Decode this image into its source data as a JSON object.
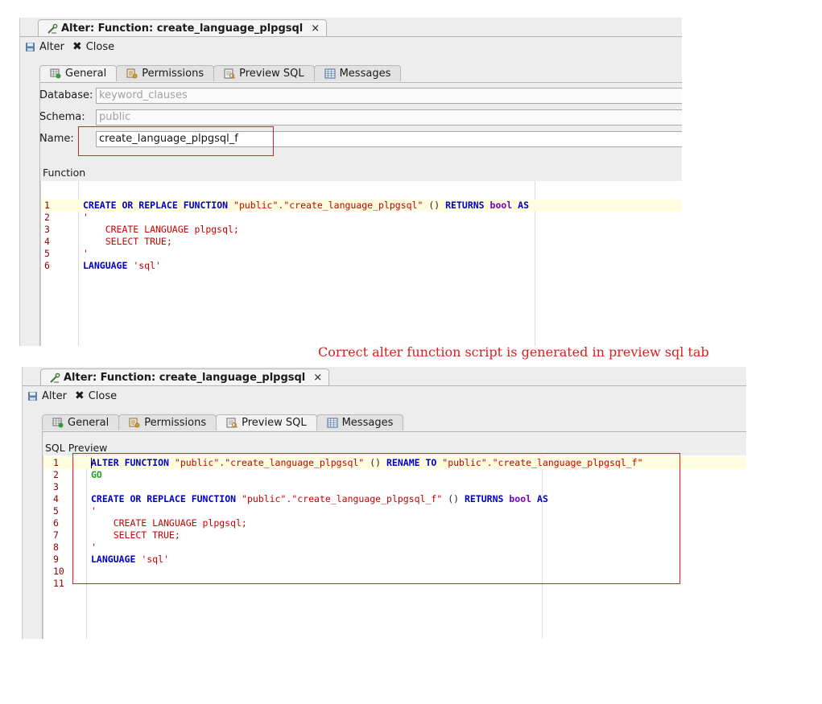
{
  "annotation": {
    "caption": "Correct alter function script is generated in preview sql tab"
  },
  "top": {
    "editor_tab_title": "Alter: Function: create_language_plpgsql",
    "close_tab": "×",
    "toolbar": {
      "alter_label": "Alter",
      "close_label": "Close"
    },
    "tabs": [
      {
        "label": "General",
        "icon": "general-table-icon",
        "active": true
      },
      {
        "label": "Permissions",
        "icon": "permissions-icon",
        "active": false
      },
      {
        "label": "Preview SQL",
        "icon": "preview-sql-icon",
        "active": false
      },
      {
        "label": "Messages",
        "icon": "messages-icon",
        "active": false
      }
    ],
    "fields": {
      "database_label": "Database:",
      "database_value": "keyword_clauses",
      "schema_label": "Schema:",
      "schema_value": "public",
      "name_label": "Name:",
      "name_value": "create_language_plpgsql_f"
    },
    "section_title": "Function",
    "code": [
      {
        "n": "1",
        "tokens": [
          [
            "kw",
            "CREATE"
          ],
          [
            "pln",
            " "
          ],
          [
            "kw",
            "OR"
          ],
          [
            "pln",
            " "
          ],
          [
            "kw",
            "REPLACE"
          ],
          [
            "pln",
            " "
          ],
          [
            "kw",
            "FUNCTION"
          ],
          [
            "pln",
            " "
          ],
          [
            "str",
            "\"public\".\"create_language_plpgsql\""
          ],
          [
            "pln",
            " () "
          ],
          [
            "kw",
            "RETURNS"
          ],
          [
            "pln",
            " "
          ],
          [
            "typ",
            "bool"
          ],
          [
            "pln",
            " "
          ],
          [
            "kw",
            "AS"
          ]
        ]
      },
      {
        "n": "2",
        "tokens": [
          [
            "str",
            "'"
          ]
        ]
      },
      {
        "n": "3",
        "tokens": [
          [
            "str",
            "    CREATE LANGUAGE plpgsql;"
          ]
        ]
      },
      {
        "n": "4",
        "tokens": [
          [
            "str",
            "    SELECT TRUE;"
          ]
        ]
      },
      {
        "n": "5",
        "tokens": [
          [
            "str",
            "'"
          ]
        ]
      },
      {
        "n": "6",
        "tokens": [
          [
            "kw",
            "LANGUAGE"
          ],
          [
            "pln",
            " "
          ],
          [
            "str",
            "'sql'"
          ]
        ]
      }
    ]
  },
  "bottom": {
    "editor_tab_title": "Alter: Function: create_language_plpgsql",
    "close_tab": "×",
    "toolbar": {
      "alter_label": "Alter",
      "close_label": "Close"
    },
    "tabs": [
      {
        "label": "General",
        "icon": "general-table-icon",
        "active": false
      },
      {
        "label": "Permissions",
        "icon": "permissions-icon",
        "active": false
      },
      {
        "label": "Preview SQL",
        "icon": "preview-sql-icon",
        "active": true
      },
      {
        "label": "Messages",
        "icon": "messages-icon",
        "active": false
      }
    ],
    "section_title": "SQL Preview",
    "code": [
      {
        "n": "1",
        "tokens": [
          [
            "kw",
            "ALTER"
          ],
          [
            "pln",
            " "
          ],
          [
            "kw",
            "FUNCTION"
          ],
          [
            "pln",
            " "
          ],
          [
            "str",
            "\"public\".\"create_language_plpgsql\""
          ],
          [
            "pln",
            " () "
          ],
          [
            "kw",
            "RENAME"
          ],
          [
            "pln",
            " "
          ],
          [
            "kw",
            "TO"
          ],
          [
            "pln",
            " "
          ],
          [
            "str",
            "\"public\".\"create_language_plpgsql_f\""
          ]
        ]
      },
      {
        "n": "2",
        "tokens": [
          [
            "go",
            "GO"
          ]
        ]
      },
      {
        "n": "3",
        "tokens": []
      },
      {
        "n": "4",
        "tokens": [
          [
            "kw",
            "CREATE"
          ],
          [
            "pln",
            " "
          ],
          [
            "kw",
            "OR"
          ],
          [
            "pln",
            " "
          ],
          [
            "kw",
            "REPLACE"
          ],
          [
            "pln",
            " "
          ],
          [
            "kw",
            "FUNCTION"
          ],
          [
            "pln",
            " "
          ],
          [
            "str",
            "\"public\".\"create_language_plpgsql_f\""
          ],
          [
            "pln",
            " () "
          ],
          [
            "kw",
            "RETURNS"
          ],
          [
            "pln",
            " "
          ],
          [
            "typ",
            "bool"
          ],
          [
            "pln",
            " "
          ],
          [
            "kw",
            "AS"
          ]
        ]
      },
      {
        "n": "5",
        "tokens": [
          [
            "str",
            "'"
          ]
        ]
      },
      {
        "n": "6",
        "tokens": [
          [
            "str",
            "    CREATE LANGUAGE plpgsql;"
          ]
        ]
      },
      {
        "n": "7",
        "tokens": [
          [
            "str",
            "    SELECT TRUE;"
          ]
        ]
      },
      {
        "n": "8",
        "tokens": [
          [
            "str",
            "'"
          ]
        ]
      },
      {
        "n": "9",
        "tokens": [
          [
            "kw",
            "LANGUAGE"
          ],
          [
            "pln",
            " "
          ],
          [
            "str",
            "'sql'"
          ]
        ]
      },
      {
        "n": "10",
        "tokens": []
      },
      {
        "n": "11",
        "tokens": []
      }
    ]
  }
}
